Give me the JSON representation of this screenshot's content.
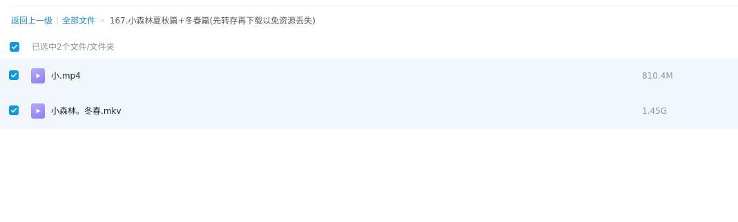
{
  "breadcrumb": {
    "back_label": "返回上一级",
    "separator": "|",
    "all_files_label": "全部文件",
    "arrow": "»",
    "current_folder": "167.小森林夏秋篇+冬春篇(先转存再下载以免资源丢失)"
  },
  "selection": {
    "summary": "已选中2个文件/文件夹",
    "all_checked": true
  },
  "files": [
    {
      "name": "小.mp4",
      "size": "810.4M",
      "checked": true,
      "icon": "video-file-icon"
    },
    {
      "name": "小森林。冬春.mkv",
      "size": "1.45G",
      "checked": true,
      "icon": "video-file-icon"
    }
  ],
  "colors": {
    "accent": "#0b98e8",
    "link": "#1a8fd9",
    "row_highlight": "#f1f7fd",
    "video_icon": "#9d8cfa"
  }
}
